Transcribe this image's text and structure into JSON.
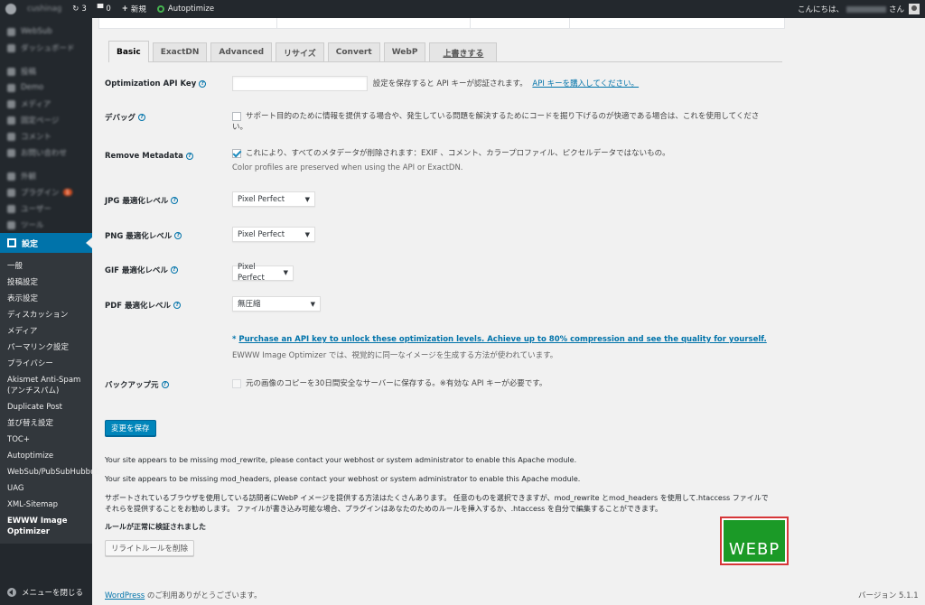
{
  "adminbar": {
    "site_name": "cushinag",
    "comments_count": "3",
    "pending_count": "0",
    "new_label": "新規",
    "plugin_label": "Autoptimize",
    "greeting": "こんにちは、",
    "greeting_suffix": "さん"
  },
  "sidebar": {
    "blurred_items": [
      "WebSub",
      "ダッシュボード",
      "投稿",
      "Demo",
      "メディア",
      "固定ページ",
      "コメント",
      "お問い合わせ",
      "外観",
      "プラグイン",
      "ユーザー",
      "ツール"
    ],
    "plugins_badge": "1",
    "current": "設定",
    "submenu": [
      "一般",
      "投稿設定",
      "表示設定",
      "ディスカッション",
      "メディア",
      "パーマリンク設定",
      "プライバシー",
      "Akismet Anti-Spam (アンチスパム)",
      "Duplicate Post",
      "並び替え設定",
      "TOC+",
      "Autoptimize",
      "WebSub/PubSubHubbub",
      "UAG",
      "XML-Sitemap",
      "EWWW Image Optimizer"
    ],
    "collapse": "メニューを閉じる"
  },
  "tabs": [
    "Basic",
    "ExactDN",
    "Advanced",
    "リサイズ",
    "Convert",
    "WebP",
    "上書きする"
  ],
  "form": {
    "api_key": {
      "label": "Optimization API Key",
      "value": "",
      "note": "設定を保存すると API キーが認証されます。",
      "link": "API キーを購入してください。"
    },
    "debug": {
      "label": "デバッグ",
      "text": "サポート目的のために情報を提供する場合や、発生している問題を解決するためにコードを掘り下げるのが快適である場合は、これを使用してください。"
    },
    "metadata": {
      "label": "Remove Metadata",
      "text": "これにより、すべてのメタデータが削除されます：EXIF 、コメント、カラープロファイル、ピクセルデータではないもの。",
      "sub": "Color profiles are preserved when using the API or ExactDN."
    },
    "jpg": {
      "label": "JPG 最適化レベル",
      "value": "Pixel Perfect"
    },
    "png": {
      "label": "PNG 最適化レベル",
      "value": "Pixel Perfect"
    },
    "gif": {
      "label": "GIF 最適化レベル",
      "value": "Pixel Perfect"
    },
    "pdf": {
      "label": "PDF 最適化レベル",
      "value": "無圧縮"
    },
    "purchase_prefix": "* ",
    "purchase_link": "Purchase an API key to unlock these optimization levels. Achieve up to 80% compression and see the quality for yourself.",
    "purchase_note": "EWWW Image Optimizer では、視覚的に同一なイメージを生成する方法が使われています。",
    "backup": {
      "label": "バックアップ元",
      "text": "元の画像のコピーを30日間安全なサーバーに保存する。※有効な API キーが必要です。"
    },
    "save_button": "変更を保存"
  },
  "notices": {
    "rewrite": "Your site appears to be missing mod_rewrite, please contact your webhost or system administrator to enable this Apache module.",
    "headers": "Your site appears to be missing mod_headers, please contact your webhost or system administrator to enable this Apache module.",
    "webp_info_1": "サポートされているブラウザを使用している訪問者にWebP イメージを提供する方法はたくさんあります。 任意のものを選択できますが、mod_rewrite とmod_headers を使用して.htaccess ファイルで",
    "webp_info_2": "それらを提供することをお勧めします。 ファイルが書き込み可能な場合、プラグインはあなたのためのルールを挿入するか、.htaccess を自分で編集することができます。",
    "rules_verified": "ルールが正常に検証されました",
    "remove_button": "リライトルールを削除",
    "webp_badge": "WEBP"
  },
  "footer": {
    "wp_link": "WordPress",
    "thanks": " のご利用ありがとうございます。",
    "version": "バージョン 5.1.1"
  }
}
